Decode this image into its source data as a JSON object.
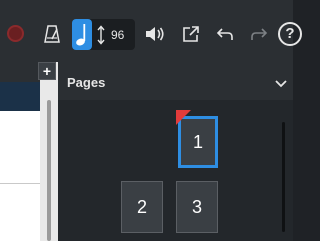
{
  "toolbar": {
    "tempo": "96",
    "icons": [
      "record-icon",
      "metronome-icon",
      "quarter-note-icon",
      "tempo-arrows-icon",
      "volume-icon",
      "share-icon",
      "undo-icon",
      "redo-icon",
      "help-icon"
    ],
    "help_label": "?"
  },
  "score": {
    "add_label": "+"
  },
  "pages_panel": {
    "title": "Pages",
    "pages": [
      {
        "label": "1",
        "selected": true,
        "flagged": true
      },
      {
        "label": "2",
        "selected": false,
        "flagged": false
      },
      {
        "label": "3",
        "selected": false,
        "flagged": false
      }
    ]
  },
  "colors": {
    "accent": "#2e8ee3",
    "flag": "#e23b3b",
    "record": "#6a1f21",
    "panel_bg": "#23272b",
    "toolbar_bg": "#2b2f33"
  }
}
